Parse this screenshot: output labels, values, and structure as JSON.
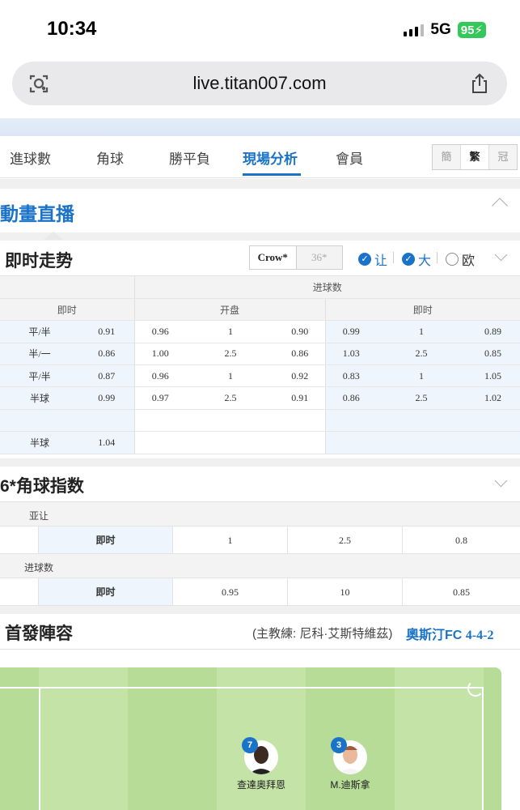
{
  "status_bar": {
    "time": "10:34",
    "network": "5G",
    "battery": "95"
  },
  "browser": {
    "url": "live.titan007.com"
  },
  "nav": {
    "tabs": [
      "進球數",
      "角球",
      "勝平負",
      "現場分析",
      "會員"
    ],
    "active_tab": "現場分析",
    "lang": [
      "簡",
      "繁",
      "冠"
    ]
  },
  "anim": {
    "title": "動畫直播"
  },
  "trend": {
    "title": "即时走势",
    "companies": [
      "Crow*",
      "36*"
    ],
    "options": [
      "让",
      "大",
      "欧"
    ],
    "table": {
      "group_header": "进球数",
      "headers": [
        "即时",
        "开盘",
        "即时"
      ],
      "rows": [
        [
          "平/半",
          "0.91",
          "0.96",
          "1",
          "0.90",
          "0.99",
          "1",
          "0.89"
        ],
        [
          "半/一",
          "0.86",
          "1.00",
          "2.5",
          "0.86",
          "1.03",
          "2.5",
          "0.85"
        ],
        [
          "平/半",
          "0.87",
          "0.96",
          "1",
          "0.92",
          "0.83",
          "1",
          "1.05"
        ],
        [
          "半球",
          "0.99",
          "0.97",
          "2.5",
          "0.91",
          "0.86",
          "2.5",
          "1.02"
        ],
        [
          "",
          "",
          "",
          "",
          "",
          "",
          "",
          ""
        ],
        [
          "半球",
          "1.04",
          "",
          "",
          "",
          "",
          "",
          ""
        ]
      ]
    }
  },
  "corner": {
    "title": "6*角球指数",
    "handicap_label": "亚让",
    "handicap_row": [
      "即时",
      "1",
      "2.5",
      "0.8"
    ],
    "total_label": "进球数",
    "total_row": [
      "即时",
      "0.95",
      "10",
      "0.85"
    ]
  },
  "lineup": {
    "title": "首發陣容",
    "coach": "(主教練: 尼科·艾斯特維茲)",
    "team": "奧斯汀FC",
    "formation": "4-4-2",
    "players": [
      {
        "number": "7",
        "name": "查達奧拜恩"
      },
      {
        "number": "3",
        "name": "M.迪斯拿"
      }
    ]
  },
  "colors": {
    "accent": "#1a73c8",
    "pitch": "#b6dc97",
    "battery": "#34c759"
  }
}
